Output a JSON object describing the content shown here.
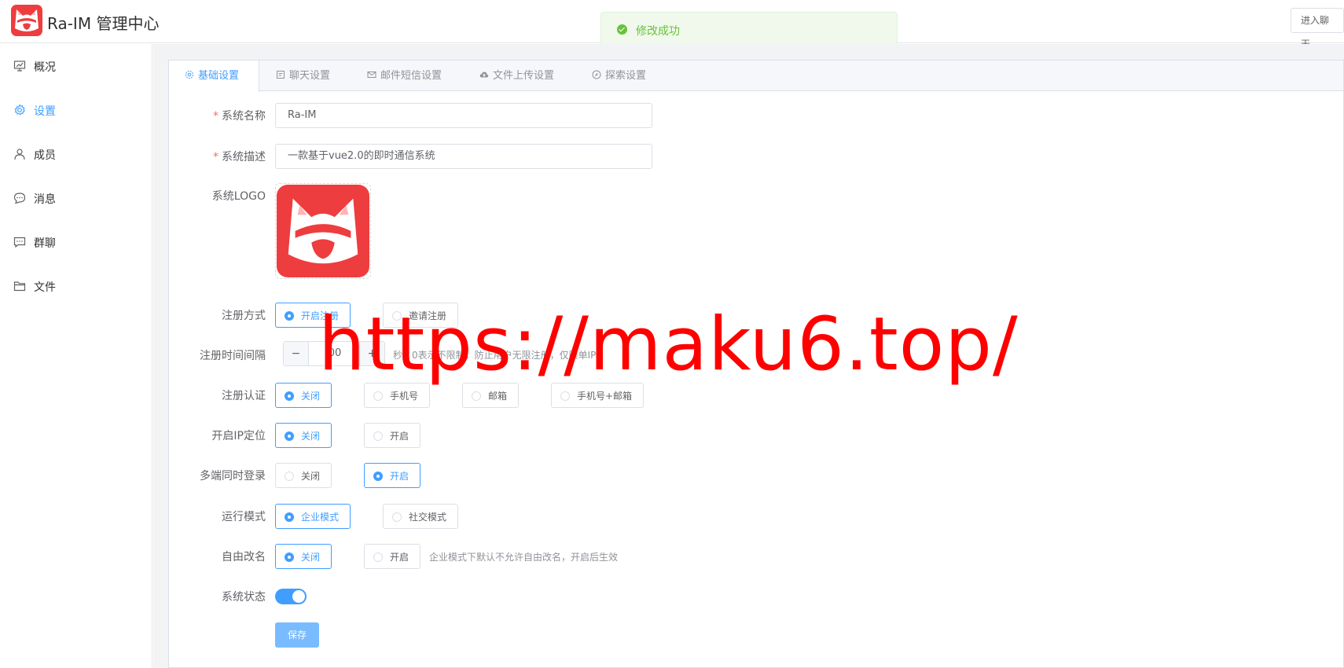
{
  "header": {
    "app_title": "Ra-IM 管理中心",
    "enter_chat_label": "进入聊天"
  },
  "toast": {
    "message": "修改成功",
    "color": "#67c23a"
  },
  "sidebar": {
    "items": [
      {
        "label": "概况",
        "icon": "chart-board-icon"
      },
      {
        "label": "设置",
        "icon": "gear-icon"
      },
      {
        "label": "成员",
        "icon": "user-icon"
      },
      {
        "label": "消息",
        "icon": "chat-bubble-icon"
      },
      {
        "label": "群聊",
        "icon": "group-chat-icon"
      },
      {
        "label": "文件",
        "icon": "folder-icon"
      }
    ]
  },
  "tabs": [
    {
      "label": "基础设置",
      "icon": "gear-icon"
    },
    {
      "label": "聊天设置",
      "icon": "document-icon"
    },
    {
      "label": "邮件短信设置",
      "icon": "mail-icon"
    },
    {
      "label": "文件上传设置",
      "icon": "cloud-upload-icon"
    },
    {
      "label": "探索设置",
      "icon": "compass-icon"
    }
  ],
  "form": {
    "system_name": {
      "label": "系统名称",
      "required_mark": "*",
      "value": "Ra-IM"
    },
    "system_desc": {
      "label": "系统描述",
      "required_mark": "*",
      "value": "一款基于vue2.0的即时通信系统"
    },
    "system_logo": {
      "label": "系统LOGO"
    },
    "register_mode": {
      "label": "注册方式",
      "options": [
        "开启注册",
        "邀请注册"
      ],
      "selected": "开启注册"
    },
    "register_interval": {
      "label": "注册时间间隔",
      "value": "00",
      "hint": "秒，0表示不限制，防止用户无限注册，仅限单IP"
    },
    "register_auth": {
      "label": "注册认证",
      "options": [
        "关闭",
        "手机号",
        "邮箱",
        "手机号+邮箱"
      ],
      "selected": "关闭"
    },
    "ip_location": {
      "label": "开启IP定位",
      "options": [
        "关闭",
        "开启"
      ],
      "selected": "关闭"
    },
    "multi_login": {
      "label": "多端同时登录",
      "options": [
        "关闭",
        "开启"
      ],
      "selected": "开启"
    },
    "run_mode": {
      "label": "运行模式",
      "options": [
        "企业模式",
        "社交模式"
      ],
      "selected": "企业模式"
    },
    "free_rename": {
      "label": "自由改名",
      "options": [
        "关闭",
        "开启"
      ],
      "selected": "关闭",
      "hint": "企业模式下默认不允许自由改名，开启后生效"
    },
    "system_status": {
      "label": "系统状态",
      "enabled": true
    },
    "save_label": "保存"
  },
  "watermark": "https://maku6.top/",
  "colors": {
    "accent": "#409eff",
    "danger": "#f56c6c",
    "logo": "#ee3d3f"
  }
}
